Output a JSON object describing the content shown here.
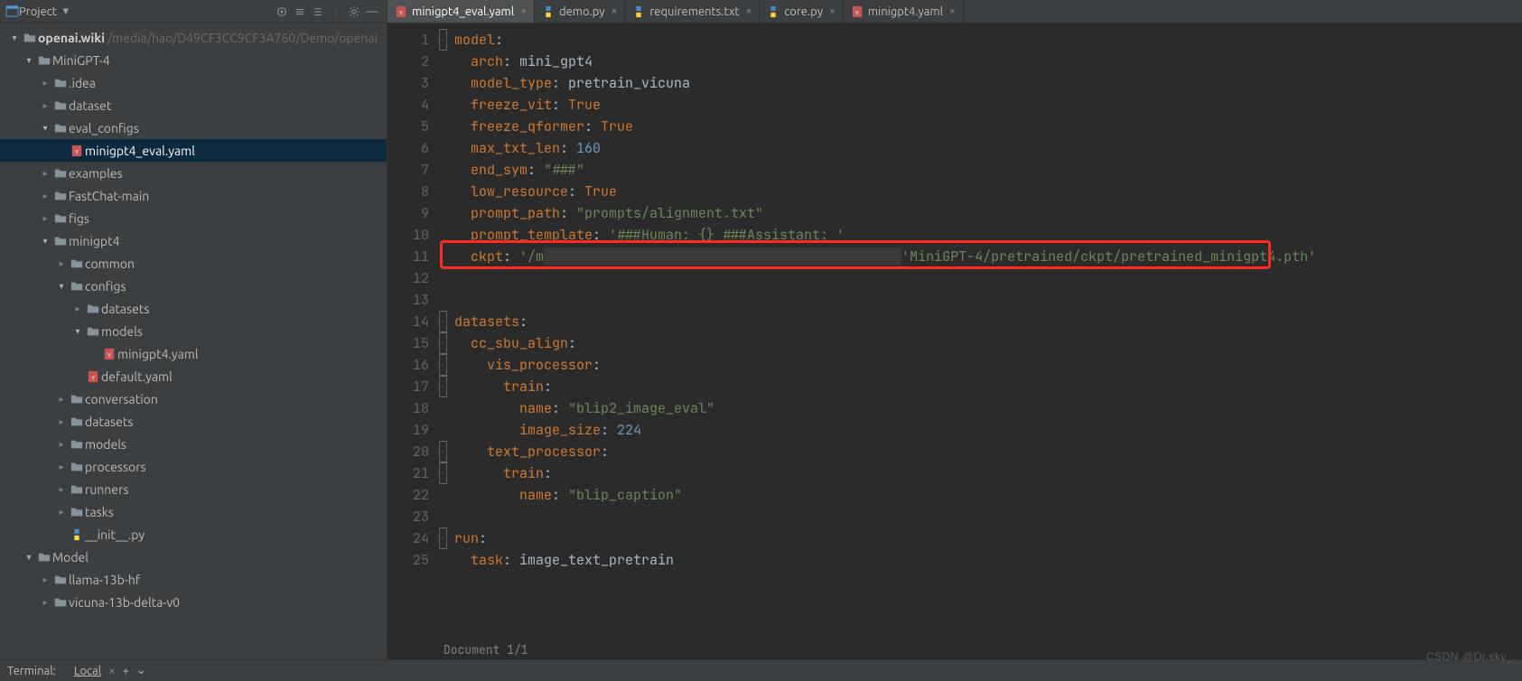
{
  "project": {
    "label": "Project",
    "root_name": "openai.wiki",
    "root_path": "/media/hao/D49CF3CC9CF3A760/Demo/openai"
  },
  "tree": [
    {
      "depth": 0,
      "arrow": "open",
      "icon": "folder-root",
      "label": "openai.wiki",
      "suffix": "/media/hao/D49CF3CC9CF3A760/Demo/openai",
      "sel": false
    },
    {
      "depth": 1,
      "arrow": "open",
      "icon": "folder",
      "label": "MiniGPT-4",
      "sel": false
    },
    {
      "depth": 2,
      "arrow": "closed",
      "icon": "folder",
      "label": ".idea",
      "sel": false
    },
    {
      "depth": 2,
      "arrow": "closed",
      "icon": "folder",
      "label": "dataset",
      "sel": false
    },
    {
      "depth": 2,
      "arrow": "open",
      "icon": "folder",
      "label": "eval_configs",
      "sel": false
    },
    {
      "depth": 3,
      "arrow": "none",
      "icon": "yaml",
      "label": "minigpt4_eval.yaml",
      "sel": true
    },
    {
      "depth": 2,
      "arrow": "closed",
      "icon": "folder",
      "label": "examples",
      "sel": false
    },
    {
      "depth": 2,
      "arrow": "closed",
      "icon": "folder",
      "label": "FastChat-main",
      "sel": false
    },
    {
      "depth": 2,
      "arrow": "closed",
      "icon": "folder",
      "label": "figs",
      "sel": false
    },
    {
      "depth": 2,
      "arrow": "open",
      "icon": "folder",
      "label": "minigpt4",
      "sel": false
    },
    {
      "depth": 3,
      "arrow": "closed",
      "icon": "folder",
      "label": "common",
      "sel": false
    },
    {
      "depth": 3,
      "arrow": "open",
      "icon": "folder",
      "label": "configs",
      "sel": false
    },
    {
      "depth": 4,
      "arrow": "closed",
      "icon": "folder",
      "label": "datasets",
      "sel": false
    },
    {
      "depth": 4,
      "arrow": "open",
      "icon": "folder",
      "label": "models",
      "sel": false
    },
    {
      "depth": 5,
      "arrow": "none",
      "icon": "yaml",
      "label": "minigpt4.yaml",
      "sel": false
    },
    {
      "depth": 4,
      "arrow": "none",
      "icon": "yaml",
      "label": "default.yaml",
      "sel": false
    },
    {
      "depth": 3,
      "arrow": "closed",
      "icon": "folder",
      "label": "conversation",
      "sel": false
    },
    {
      "depth": 3,
      "arrow": "closed",
      "icon": "folder",
      "label": "datasets",
      "sel": false
    },
    {
      "depth": 3,
      "arrow": "closed",
      "icon": "folder",
      "label": "models",
      "sel": false
    },
    {
      "depth": 3,
      "arrow": "closed",
      "icon": "folder",
      "label": "processors",
      "sel": false
    },
    {
      "depth": 3,
      "arrow": "closed",
      "icon": "folder",
      "label": "runners",
      "sel": false
    },
    {
      "depth": 3,
      "arrow": "closed",
      "icon": "folder",
      "label": "tasks",
      "sel": false
    },
    {
      "depth": 3,
      "arrow": "none",
      "icon": "py",
      "label": "__init__.py",
      "sel": false
    },
    {
      "depth": 1,
      "arrow": "open",
      "icon": "folder",
      "label": "Model",
      "sel": false
    },
    {
      "depth": 2,
      "arrow": "closed",
      "icon": "folder",
      "label": "llama-13b-hf",
      "sel": false
    },
    {
      "depth": 2,
      "arrow": "closed",
      "icon": "folder",
      "label": "vicuna-13b-delta-v0",
      "sel": false
    }
  ],
  "tabs": [
    {
      "icon": "yaml",
      "label": "minigpt4_eval.yaml",
      "active": true
    },
    {
      "icon": "py",
      "label": "demo.py",
      "active": false
    },
    {
      "icon": "py",
      "label": "requirements.txt",
      "active": false
    },
    {
      "icon": "py",
      "label": "core.py",
      "active": false
    },
    {
      "icon": "yaml",
      "label": "minigpt4.yaml",
      "active": false
    }
  ],
  "code_lines": [
    {
      "n": 1,
      "fold": "open",
      "segs": [
        [
          "key",
          "model"
        ],
        [
          "plain",
          ":"
        ]
      ]
    },
    {
      "n": 2,
      "fold": "",
      "segs": [
        [
          "plain",
          "  "
        ],
        [
          "key",
          "arch"
        ],
        [
          "plain",
          ": "
        ],
        [
          "plain",
          "mini_gpt4"
        ]
      ]
    },
    {
      "n": 3,
      "fold": "",
      "segs": [
        [
          "plain",
          "  "
        ],
        [
          "key",
          "model_type"
        ],
        [
          "plain",
          ": "
        ],
        [
          "plain",
          "pretrain_vicuna"
        ]
      ]
    },
    {
      "n": 4,
      "fold": "",
      "segs": [
        [
          "plain",
          "  "
        ],
        [
          "key",
          "freeze_vit"
        ],
        [
          "plain",
          ": "
        ],
        [
          "bool",
          "True"
        ]
      ]
    },
    {
      "n": 5,
      "fold": "",
      "segs": [
        [
          "plain",
          "  "
        ],
        [
          "key",
          "freeze_qformer"
        ],
        [
          "plain",
          ": "
        ],
        [
          "bool",
          "True"
        ]
      ]
    },
    {
      "n": 6,
      "fold": "",
      "segs": [
        [
          "plain",
          "  "
        ],
        [
          "key",
          "max_txt_len"
        ],
        [
          "plain",
          ": "
        ],
        [
          "num",
          "160"
        ]
      ]
    },
    {
      "n": 7,
      "fold": "",
      "segs": [
        [
          "plain",
          "  "
        ],
        [
          "key",
          "end_sym"
        ],
        [
          "plain",
          ": "
        ],
        [
          "str",
          "\"###\""
        ]
      ]
    },
    {
      "n": 8,
      "fold": "",
      "segs": [
        [
          "plain",
          "  "
        ],
        [
          "key",
          "low_resource"
        ],
        [
          "plain",
          ": "
        ],
        [
          "bool",
          "True"
        ]
      ]
    },
    {
      "n": 9,
      "fold": "",
      "segs": [
        [
          "plain",
          "  "
        ],
        [
          "key",
          "prompt_path"
        ],
        [
          "plain",
          ": "
        ],
        [
          "str",
          "\"prompts/alignment.txt\""
        ]
      ]
    },
    {
      "n": 10,
      "fold": "",
      "segs": [
        [
          "plain",
          "  "
        ],
        [
          "key",
          "prompt_template"
        ],
        [
          "plain",
          ": "
        ],
        [
          "str",
          "'###Human: {} ###Assistant: '"
        ]
      ]
    },
    {
      "n": 11,
      "fold": "",
      "hl": true,
      "segs": [
        [
          "plain",
          "  "
        ],
        [
          "key",
          "ckpt"
        ],
        [
          "plain",
          ": "
        ],
        [
          "str",
          "'/m"
        ],
        [
          "redact",
          "                                            "
        ],
        [
          "str",
          "'MiniGPT-4/pretrained/ckpt/pretrained_minigpt4.pth'"
        ]
      ]
    },
    {
      "n": 12,
      "fold": "",
      "segs": [
        [
          "plain",
          ""
        ]
      ]
    },
    {
      "n": 13,
      "fold": "",
      "segs": [
        [
          "plain",
          ""
        ]
      ]
    },
    {
      "n": 14,
      "fold": "open",
      "segs": [
        [
          "key",
          "datasets"
        ],
        [
          "plain",
          ":"
        ]
      ]
    },
    {
      "n": 15,
      "fold": "open",
      "segs": [
        [
          "plain",
          "  "
        ],
        [
          "key",
          "cc_sbu_align"
        ],
        [
          "plain",
          ":"
        ]
      ]
    },
    {
      "n": 16,
      "fold": "open",
      "segs": [
        [
          "plain",
          "    "
        ],
        [
          "key",
          "vis_processor"
        ],
        [
          "plain",
          ":"
        ]
      ]
    },
    {
      "n": 17,
      "fold": "open",
      "segs": [
        [
          "plain",
          "      "
        ],
        [
          "key",
          "train"
        ],
        [
          "plain",
          ":"
        ]
      ]
    },
    {
      "n": 18,
      "fold": "",
      "segs": [
        [
          "plain",
          "        "
        ],
        [
          "key",
          "name"
        ],
        [
          "plain",
          ": "
        ],
        [
          "str",
          "\"blip2_image_eval\""
        ]
      ]
    },
    {
      "n": 19,
      "fold": "",
      "segs": [
        [
          "plain",
          "        "
        ],
        [
          "key",
          "image_size"
        ],
        [
          "plain",
          ": "
        ],
        [
          "num",
          "224"
        ]
      ]
    },
    {
      "n": 20,
      "fold": "open",
      "segs": [
        [
          "plain",
          "    "
        ],
        [
          "key",
          "text_processor"
        ],
        [
          "plain",
          ":"
        ]
      ]
    },
    {
      "n": 21,
      "fold": "open",
      "segs": [
        [
          "plain",
          "      "
        ],
        [
          "key",
          "train"
        ],
        [
          "plain",
          ":"
        ]
      ]
    },
    {
      "n": 22,
      "fold": "",
      "segs": [
        [
          "plain",
          "        "
        ],
        [
          "key",
          "name"
        ],
        [
          "plain",
          ": "
        ],
        [
          "str",
          "\"blip_caption\""
        ]
      ]
    },
    {
      "n": 23,
      "fold": "",
      "segs": [
        [
          "plain",
          ""
        ]
      ]
    },
    {
      "n": 24,
      "fold": "open",
      "segs": [
        [
          "key",
          "run"
        ],
        [
          "plain",
          ":"
        ]
      ]
    },
    {
      "n": 25,
      "fold": "",
      "segs": [
        [
          "plain",
          "  "
        ],
        [
          "key",
          "task"
        ],
        [
          "plain",
          ": "
        ],
        [
          "plain",
          "image_text_pretrain"
        ]
      ]
    }
  ],
  "status": {
    "text": "Document 1/1"
  },
  "terminal": {
    "title": "Terminal:",
    "tab": "Local"
  },
  "watermark": "CSDN @Dr.sky_"
}
